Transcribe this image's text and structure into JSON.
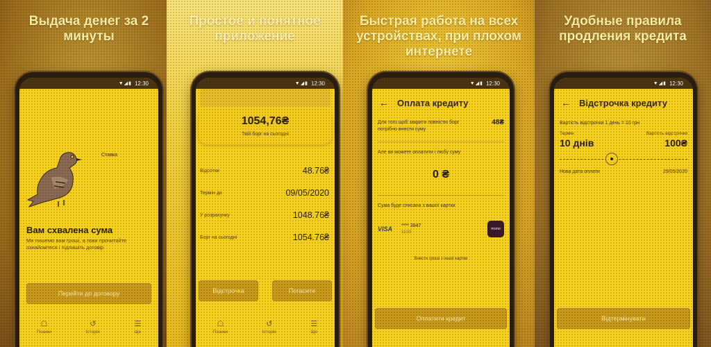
{
  "status_time": "12:30",
  "colors": {
    "accent": "#f6d21e",
    "button": "#c99a1a",
    "dark": "#2a1e10"
  },
  "panel1": {
    "headline": "Выдача денег за 2 минуты",
    "bubble": "Ставка",
    "approved_title": "Вам схвалена сума",
    "approved_text": "Ми пишемо вам гроші, а поки прочитайте ознайомтеся і підпишіть договір",
    "button": "Перейти до договору",
    "tabs": [
      {
        "icon": "loan-icon",
        "label": "Позики"
      },
      {
        "icon": "history-icon",
        "label": "Історія"
      },
      {
        "icon": "menu-icon",
        "label": "Ще"
      }
    ]
  },
  "panel2": {
    "headline": "Простое и понятное приложение",
    "debt_amount": "1054,76₴",
    "debt_caption": "Твій борг на сьогодні",
    "rows": [
      {
        "label": "Відсотки",
        "value": "48.76₴"
      },
      {
        "label": "Термін до",
        "value": "09/05/2020"
      },
      {
        "label": "У розрахунку",
        "value": "1048.76₴"
      },
      {
        "label": "Борг на сьогодні",
        "value": "1054.76₴"
      }
    ],
    "defer_button": "Відстрочка",
    "repay_button": "Погасити",
    "tabs": [
      {
        "icon": "loan-icon",
        "label": "Позики"
      },
      {
        "icon": "history-icon",
        "label": "Історія"
      },
      {
        "icon": "menu-icon",
        "label": "Ще"
      }
    ]
  },
  "panel3": {
    "headline": "Быстрая работа на всех устройствах, при плохом интернете",
    "title": "Оплата кредиту",
    "full_pay_text": "Для того щоб закрити повністю борг потрібно внести суму",
    "full_pay_amount": "48₴",
    "any_amount_text": "Але ви можете оплатити і любу суму",
    "amount_value": "0 ₴",
    "card_debit_text": "Сума буде списана з вашої картки",
    "card_brand": "VISA",
    "card_number": "**** 3947",
    "card_expiry": "11/25",
    "bank_logo": "mono",
    "other_card_link": "Внести гроші з іншої картки",
    "pay_button": "Оплатити кредит"
  },
  "panel4": {
    "headline": "Удобные правила продления кредита",
    "title": "Відстрочка кредиту",
    "cost_text": "Вартість відстрочки 1 день = 10 грн",
    "term_label": "Термін",
    "term_value": "10 днів",
    "cost_label": "Вартість відстрочки",
    "cost_value": "100₴",
    "slider_level": 0.4,
    "new_date_label": "Нова дата оплати",
    "new_date_value": "29/05/2020",
    "button": "Відтермінувати"
  }
}
